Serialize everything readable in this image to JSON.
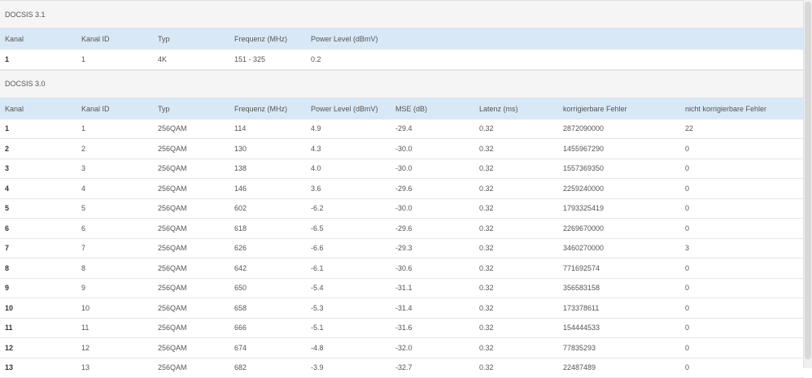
{
  "docsis31": {
    "title": "DOCSIS 3.1",
    "headers": [
      "Kanal",
      "Kanal ID",
      "Typ",
      "Frequenz (MHz)",
      "Power Level (dBmV)"
    ],
    "rows": [
      [
        "1",
        "1",
        "4K",
        "151 - 325",
        "0.2"
      ]
    ]
  },
  "docsis30": {
    "title": "DOCSIS 3.0",
    "headers": [
      "Kanal",
      "Kanal ID",
      "Typ",
      "Frequenz (MHz)",
      "Power Level (dBmV)",
      "MSE (dB)",
      "Latenz (ms)",
      "korrigierbare Fehler",
      "nicht korrigierbare Fehler"
    ],
    "rows": [
      [
        "1",
        "1",
        "256QAM",
        "114",
        "4.9",
        "-29.4",
        "0.32",
        "2872090000",
        "22"
      ],
      [
        "2",
        "2",
        "256QAM",
        "130",
        "4.3",
        "-30.0",
        "0.32",
        "1455967290",
        "0"
      ],
      [
        "3",
        "3",
        "256QAM",
        "138",
        "4.0",
        "-30.0",
        "0.32",
        "1557369350",
        "0"
      ],
      [
        "4",
        "4",
        "256QAM",
        "146",
        "3.6",
        "-29.6",
        "0.32",
        "2259240000",
        "0"
      ],
      [
        "5",
        "5",
        "256QAM",
        "602",
        "-6.2",
        "-30.0",
        "0.32",
        "1793325419",
        "0"
      ],
      [
        "6",
        "6",
        "256QAM",
        "618",
        "-6.5",
        "-29.6",
        "0.32",
        "2269670000",
        "0"
      ],
      [
        "7",
        "7",
        "256QAM",
        "626",
        "-6.6",
        "-29.3",
        "0.32",
        "3460270000",
        "3"
      ],
      [
        "8",
        "8",
        "256QAM",
        "642",
        "-6.1",
        "-30.6",
        "0.32",
        "771692574",
        "0"
      ],
      [
        "9",
        "9",
        "256QAM",
        "650",
        "-5.4",
        "-31.1",
        "0.32",
        "356583158",
        "0"
      ],
      [
        "10",
        "10",
        "256QAM",
        "658",
        "-5.3",
        "-31.4",
        "0.32",
        "173378611",
        "0"
      ],
      [
        "11",
        "11",
        "256QAM",
        "666",
        "-5.1",
        "-31.6",
        "0.32",
        "154444533",
        "0"
      ],
      [
        "12",
        "12",
        "256QAM",
        "674",
        "-4.8",
        "-32.0",
        "0.32",
        "77835293",
        "0"
      ],
      [
        "13",
        "13",
        "256QAM",
        "682",
        "-3.9",
        "-32.7",
        "0.32",
        "22487489",
        "0"
      ]
    ]
  }
}
